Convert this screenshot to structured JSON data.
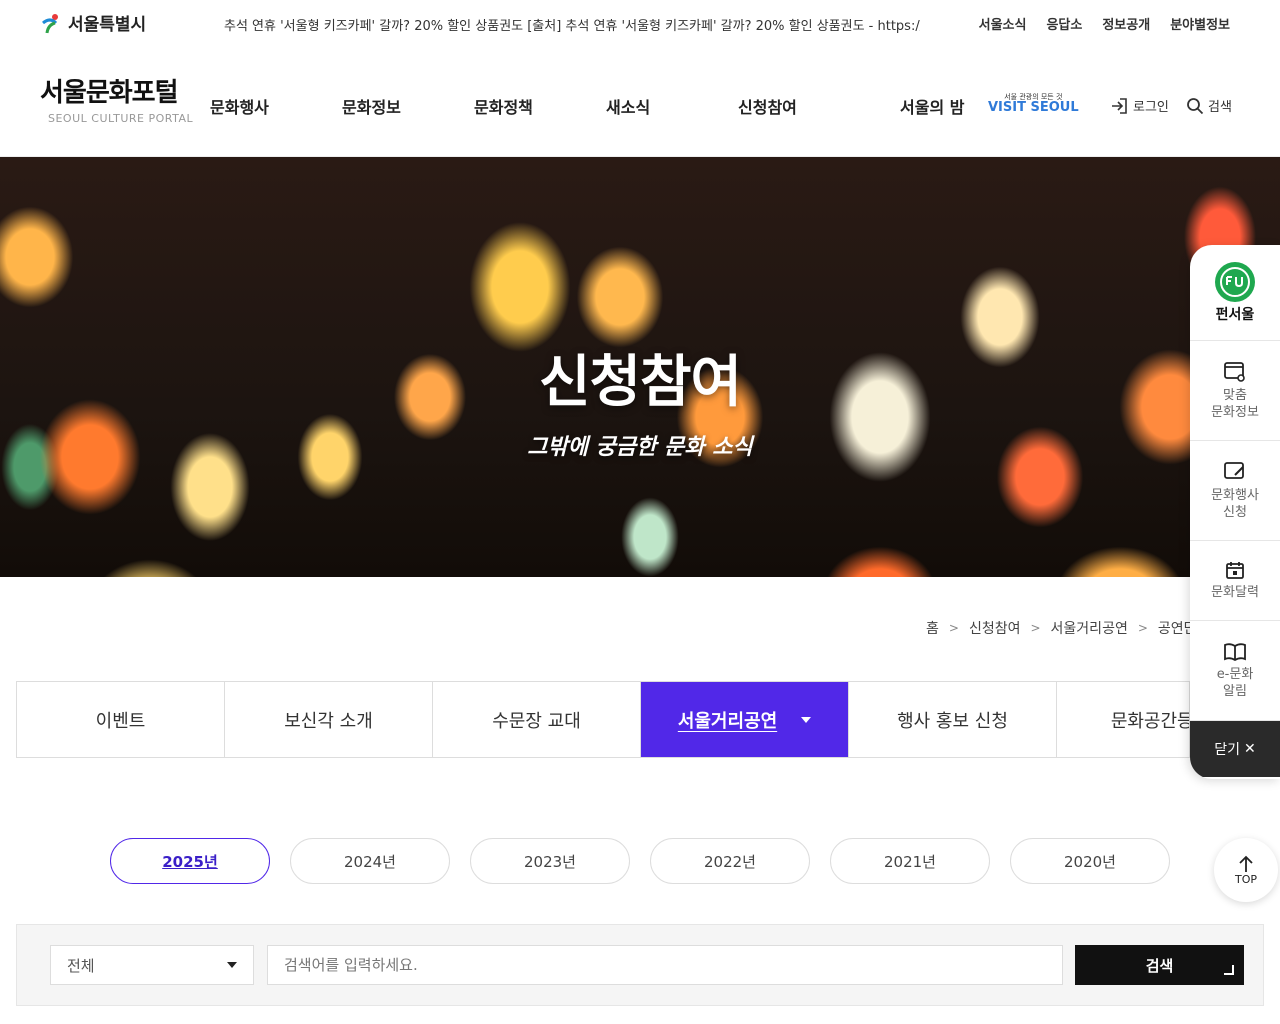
{
  "topbar": {
    "seoul_logo": "서울특별시",
    "ticker": "추석 연휴 '서울형 키즈카페' 갈까? 20% 할인 상품권도 [출처] 추석 연휴 '서울형 키즈카페' 갈까? 20% 할인 상품권도 - https://med...",
    "util": [
      "서울소식",
      "응답소",
      "정보공개",
      "분야별정보"
    ]
  },
  "gnb": {
    "brand_ko": "서울문화포털",
    "brand_en": "SEOUL CULTURE PORTAL",
    "menu": [
      "문화행사",
      "문화정보",
      "문화정책",
      "새소식",
      "신청참여"
    ],
    "night": "서울의 밤",
    "visit_small": "서울 관광의 모든 것",
    "visit_big": "VISIT SEOUL",
    "login": "로그인",
    "search": "검색"
  },
  "hero": {
    "title": "신청참여",
    "subtitle": "그밖에 궁금한 문화 소식"
  },
  "breadcrumb": [
    "홈",
    "신청참여",
    "서울거리공연",
    "공연단"
  ],
  "tabs": [
    "이벤트",
    "보신각 소개",
    "수문장 교대",
    "서울거리공연",
    "행사 홍보 신청",
    "문화공간등록"
  ],
  "active_tab": 3,
  "years": [
    "2025년",
    "2024년",
    "2023년",
    "2022년",
    "2021년",
    "2020년"
  ],
  "search": {
    "select_value": "전체",
    "placeholder": "검색어를 입력하세요.",
    "button": "검색"
  },
  "top_button": "TOP",
  "quick_menu": {
    "fun": "펀서울",
    "items": [
      {
        "line1": "맞춤",
        "line2": "문화정보"
      },
      {
        "line1": "문화행사",
        "line2": "신청"
      },
      {
        "line1": "문화달력",
        "line2": ""
      },
      {
        "line1": "e-문화",
        "line2": "알림"
      }
    ],
    "close": "닫기"
  },
  "colors": {
    "accent": "#5128e8",
    "visit_blue": "#2f7ad8",
    "dark": "#111111"
  }
}
